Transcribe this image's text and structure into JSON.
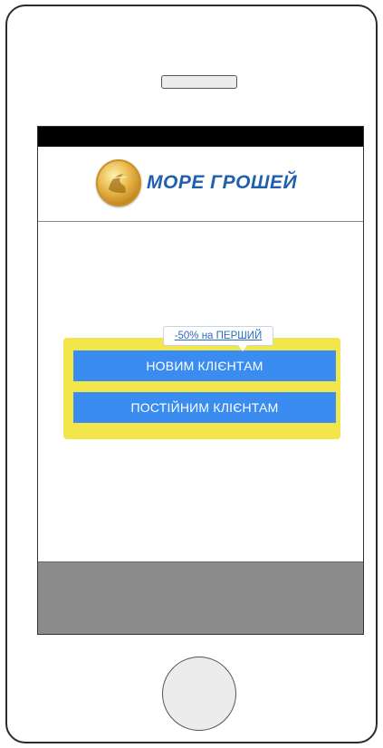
{
  "logo": {
    "brand_name": "МОРЕ ГРОШЕЙ",
    "icon": "coin-logo-icon",
    "brand_color": "#1f5fb0"
  },
  "promo": {
    "tooltip_text": "-50% на ПЕРШИЙ",
    "new_clients_label": "НОВИМ КЛІЄНТАМ",
    "regular_clients_label": "ПОСТІЙНИМ КЛІЄНТАМ"
  },
  "colors": {
    "button": "#3a8cf0",
    "panel": "#f2e64a",
    "footer": "#8c8c8c",
    "status_bar": "#000000"
  }
}
